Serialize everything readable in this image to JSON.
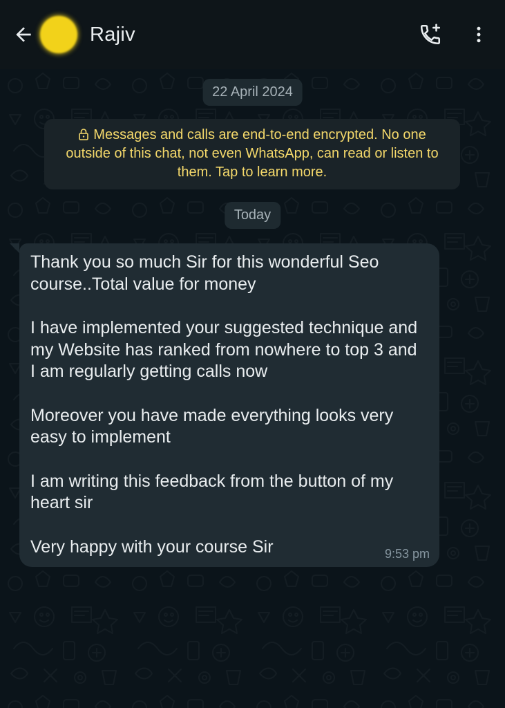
{
  "header": {
    "contact_name": "Rajiv",
    "back_icon": "arrow-left-icon",
    "call_icon": "add-call-icon",
    "menu_icon": "more-vertical-icon",
    "avatar_color": "#f2d21a"
  },
  "chat": {
    "date_chip": "22 April 2024",
    "encryption_notice": "Messages and calls are end-to-end encrypted. No one outside of this chat, not even WhatsApp, can read or listen to them. Tap to learn more.",
    "encryption_icon": "lock-icon",
    "today_chip": "Today",
    "messages": [
      {
        "direction": "incoming",
        "paragraphs": [
          "Thank you so much Sir for this wonderful Seo course..Total value for money",
          "I have implemented your suggested technique and my Website has ranked from nowhere to top 3 and I am regularly getting calls now",
          "Moreover you have made everything looks very easy to implement",
          "I am writing this feedback from the button of my heart sir",
          "Very happy with your course Sir"
        ],
        "time": "9:53 pm"
      }
    ]
  },
  "colors": {
    "background": "#0b141a",
    "header": "#0e1519",
    "bubble": "#202c33",
    "encryption_text": "#f5d96b",
    "text_primary": "#e9edef",
    "text_secondary": "#8696a0"
  }
}
